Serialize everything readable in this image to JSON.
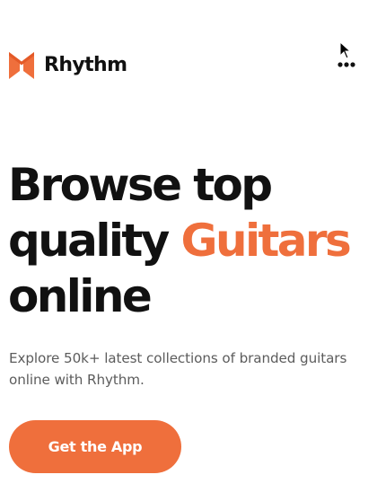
{
  "brand": {
    "name": "Rhythm",
    "logo_icon": "rhythm-logo-mark",
    "accent_color": "#EF6F3C"
  },
  "header": {
    "menu_icon": "more-dots-icon"
  },
  "hero": {
    "title_line1": "Browse top",
    "title_line2_plain": "quality",
    "title_line2_accent": "Guitars",
    "title_line3": "online",
    "subtitle": "Explore 50k+ latest collections of branded guitars online with Rhythm."
  },
  "cta": {
    "label": "Get the App"
  }
}
